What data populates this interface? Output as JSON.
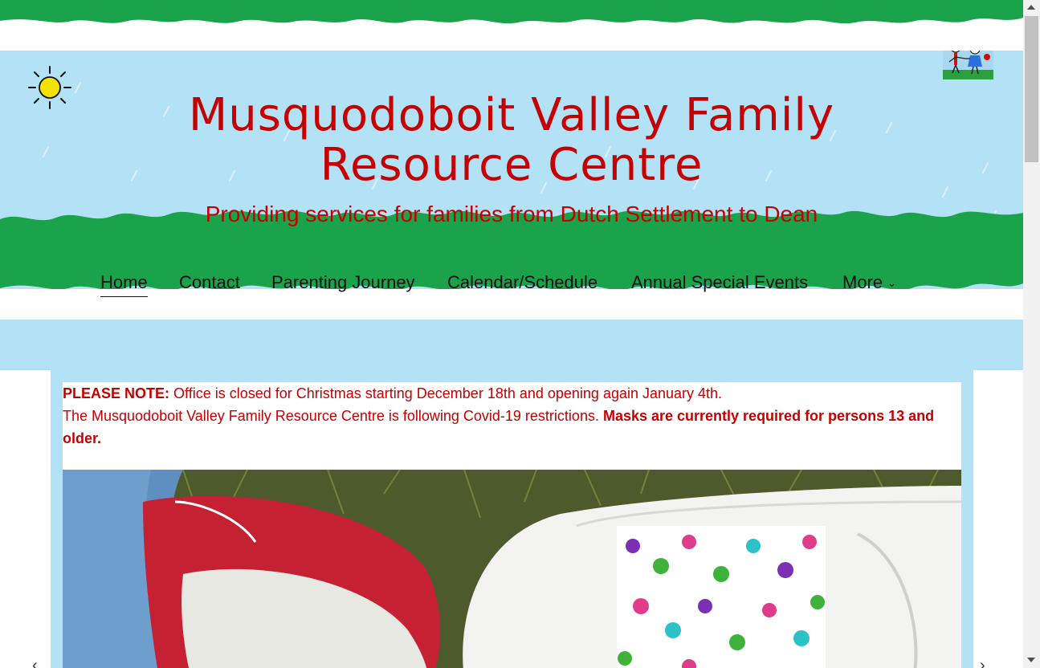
{
  "site": {
    "title": "Musquodoboit Valley Family Resource Centre",
    "tagline": "Providing services for families from Dutch Settlement to Dean"
  },
  "nav": {
    "items": [
      {
        "label": "Home",
        "active": true
      },
      {
        "label": "Contact"
      },
      {
        "label": "Parenting Journey"
      },
      {
        "label": "Calendar/Schedule"
      },
      {
        "label": "Annual Special Events"
      },
      {
        "label": "More"
      }
    ]
  },
  "notice": {
    "note_label": "PLEASE NOTE:",
    "note_text": " Office is closed for Christmas starting December 18th and opening again January 4th.",
    "covid_text": "The Musquodoboit Valley Family Resource Centre is following Covid-19 restrictions. ",
    "masks_text": "Masks are currently required for persons 13 and older."
  },
  "slider": {
    "prev_arrow": "‹",
    "next_arrow": "›"
  },
  "icons": {
    "sun": "sun-icon",
    "logo": "kids-logo-icon",
    "chevron": "chevron-down-icon"
  },
  "colors": {
    "sky": "#b3e1f6",
    "grass": "#1aa34a",
    "title_red": "#c40000"
  }
}
